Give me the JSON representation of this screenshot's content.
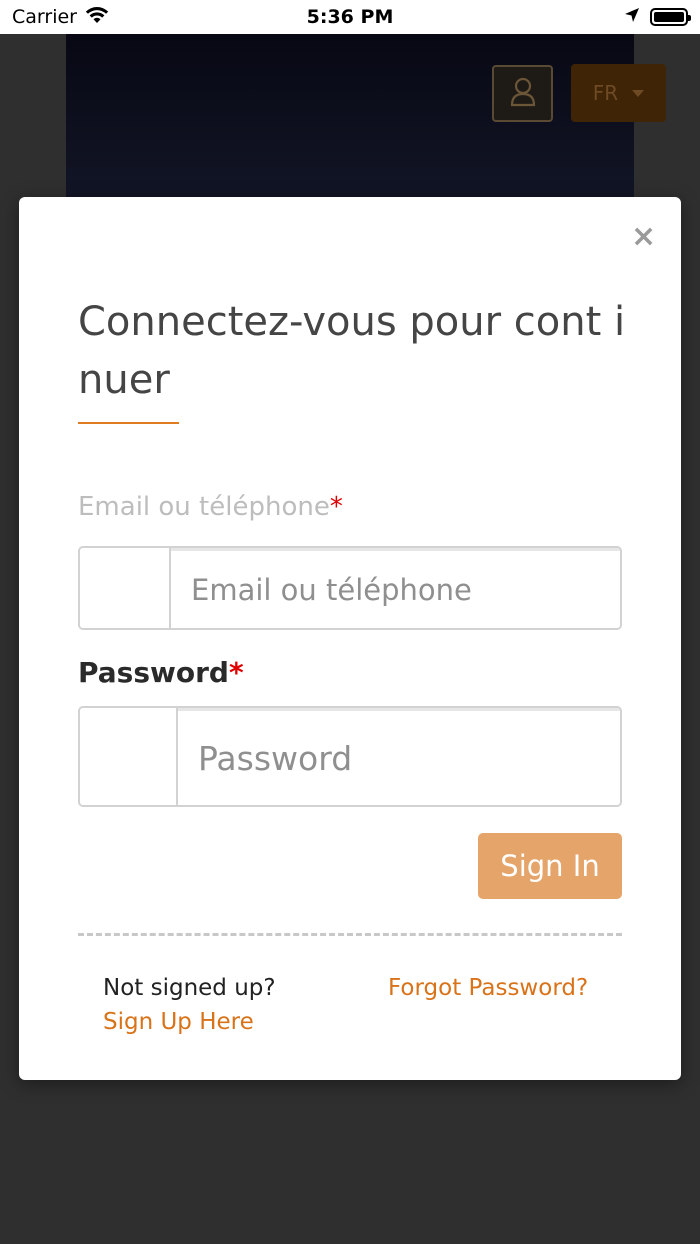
{
  "status_bar": {
    "carrier": "Carrier",
    "time": "5:36 PM"
  },
  "background": {
    "language_button": "FR",
    "icons": [
      "user-icon",
      "chevron-down-icon"
    ]
  },
  "modal": {
    "close_label": "×",
    "title": "Connectez-vous pour cont inuer",
    "email_label": "Email ou téléphone",
    "email_placeholder": "Email ou téléphone",
    "email_value": "",
    "password_label": "Password",
    "password_placeholder": "Password",
    "password_value": "",
    "required_mark": "*",
    "signin_label": "Sign In",
    "not_signed_text": "Not signed up?",
    "signup_link": "Sign Up Here",
    "forgot_link": "Forgot Password?"
  },
  "colors": {
    "accent": "#e07b1f",
    "signin_bg": "#e5a46a",
    "required": "#e00000"
  }
}
